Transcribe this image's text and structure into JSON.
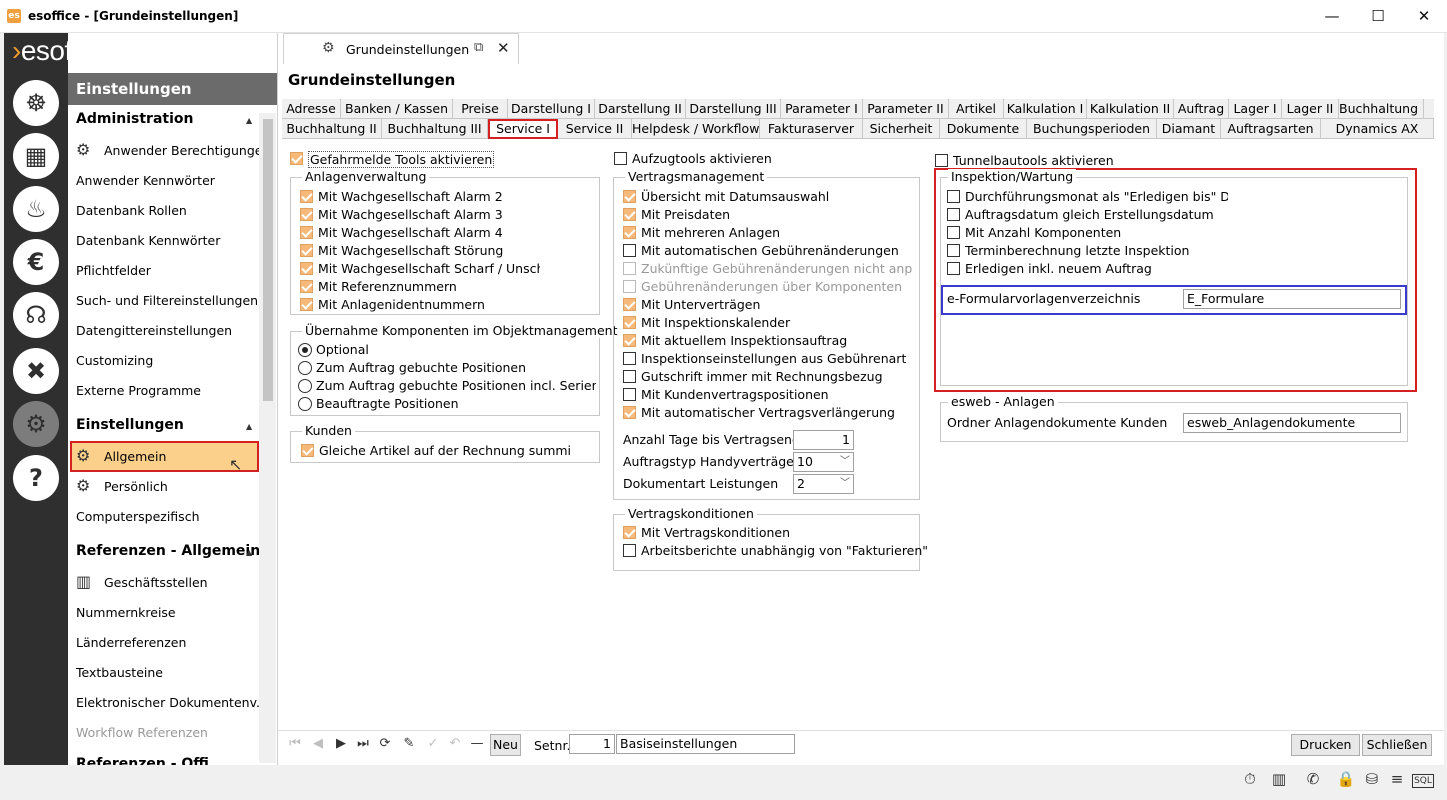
{
  "window": {
    "title": "esoffice - [Grundeinstellungen]",
    "app_icon": "esoffice-app-icon",
    "minimize": "—",
    "maximize": "☐",
    "close": "✕"
  },
  "logo": {
    "arrow": "›",
    "text": "esoffice"
  },
  "rail": [
    "helm-icon",
    "calendar-icon",
    "alarm-icon",
    "euro-icon",
    "headset-icon",
    "tools-icon",
    "gears-icon",
    "help-icon"
  ],
  "sidebar": {
    "header": "Einstellungen",
    "sections": {
      "admin": "Administration",
      "einst": "Einstellungen",
      "ref": "Referenzen - Allgemein",
      "ref2": "Referenzen - Offi..."
    },
    "admin_items": [
      "Anwender Berechtigungen",
      "Anwender Kennwörter",
      "Datenbank Rollen",
      "Datenbank Kennwörter",
      "Pflichtfelder",
      "Such- und Filtereinstellungen",
      "Datengittereinstellungen",
      "Customizing",
      "Externe Programme"
    ],
    "einst_items": [
      "Allgemein",
      "Persönlich",
      "Computerspezifisch"
    ],
    "ref_items": [
      "Geschäftsstellen",
      "Nummernkreise",
      "Länderreferenzen",
      "Textbausteine",
      "Elektronischer Dokumentenv...",
      "Workflow Referenzen"
    ]
  },
  "doc_tab": {
    "label": "Grundeinstellungen",
    "popout": "⧉",
    "close": "✕"
  },
  "page_title": "Grundeinstellungen",
  "tabs_row1": [
    "Adresse",
    "Banken / Kassen",
    "Preise",
    "Darstellung I",
    "Darstellung II",
    "Darstellung III",
    "Parameter I",
    "Parameter II",
    "Artikel",
    "Kalkulation I",
    "Kalkulation II",
    "Auftrag",
    "Lager I",
    "Lager II",
    "Buchhaltung I"
  ],
  "tabs_row2": [
    "Buchhaltung II",
    "Buchhaltung III",
    "Service I",
    "Service II",
    "Helpdesk / Workflow",
    "Fakturaserver",
    "Sicherheit",
    "Dokumente",
    "Buchungsperioden",
    "Diamant",
    "Auftragsarten",
    "Dynamics AX"
  ],
  "col1": {
    "top_check": {
      "label": "Gefahrmelde Tools aktivieren",
      "checked": true
    },
    "anlagen_title": "Anlagenverwaltung",
    "anlagen": [
      {
        "label": "Mit Wachgesellschaft Alarm 2",
        "checked": true
      },
      {
        "label": "Mit Wachgesellschaft Alarm 3",
        "checked": true
      },
      {
        "label": "Mit Wachgesellschaft Alarm 4",
        "checked": true
      },
      {
        "label": "Mit Wachgesellschaft Störung",
        "checked": true
      },
      {
        "label": "Mit Wachgesellschaft Scharf / Unscharf",
        "checked": true
      },
      {
        "label": "Mit Referenznummern",
        "checked": true
      },
      {
        "label": "Mit Anlagenidentnummern",
        "checked": true
      }
    ],
    "uebernahme_title": "Übernahme Komponenten im Objektmanagement",
    "uebernahme": [
      {
        "label": "Optional",
        "selected": true
      },
      {
        "label": "Zum Auftrag gebuchte Positionen",
        "selected": false
      },
      {
        "label": "Zum Auftrag gebuchte Positionen incl. Seriennr.",
        "selected": false
      },
      {
        "label": "Beauftragte Positionen",
        "selected": false
      }
    ],
    "kunden_title": "Kunden",
    "kunden": [
      {
        "label": "Gleiche Artikel auf der Rechnung summieren",
        "checked": true
      }
    ]
  },
  "col2": {
    "top_check": {
      "label": "Aufzugtools aktivieren",
      "checked": false
    },
    "vertrag_title": "Vertragsmanagement",
    "vertrag": [
      {
        "label": "Übersicht mit Datumsauswahl",
        "checked": true,
        "disabled": false
      },
      {
        "label": "Mit Preisdaten",
        "checked": true,
        "disabled": false
      },
      {
        "label": "Mit mehreren Anlagen",
        "checked": true,
        "disabled": false
      },
      {
        "label": "Mit automatischen Gebührenänderungen",
        "checked": false,
        "disabled": false
      },
      {
        "label": "Zukünftige Gebührenänderungen nicht anpassen",
        "checked": false,
        "disabled": true
      },
      {
        "label": "Gebührenänderungen über Komponenten",
        "checked": false,
        "disabled": true
      },
      {
        "label": "Mit Unterverträgen",
        "checked": true,
        "disabled": false
      },
      {
        "label": "Mit Inspektionskalender",
        "checked": true,
        "disabled": false
      },
      {
        "label": "Mit aktuellem Inspektionsauftrag",
        "checked": true,
        "disabled": false
      },
      {
        "label": "Inspektionseinstellungen aus Gebührenart",
        "checked": false,
        "disabled": false
      },
      {
        "label": "Gutschrift immer mit Rechnungsbezug",
        "checked": false,
        "disabled": false
      },
      {
        "label": "Mit Kundenvertragspositionen",
        "checked": false,
        "disabled": false
      },
      {
        "label": "Mit automatischer Vertragsverlängerung",
        "checked": true,
        "disabled": false
      }
    ],
    "fields": [
      {
        "label": "Anzahl Tage bis Vertragsende",
        "value": "1"
      },
      {
        "label": "Auftragstyp Handyverträge",
        "value": "10"
      },
      {
        "label": "Dokumentart Leistungen",
        "value": "2"
      }
    ],
    "kond_title": "Vertragskonditionen",
    "kond": [
      {
        "label": "Mit Vertragskonditionen",
        "checked": true
      },
      {
        "label": "Arbeitsberichte unabhängig von \"Fakturieren\"",
        "checked": false
      }
    ]
  },
  "col3": {
    "top_check": {
      "label": "Tunnelbautools aktivieren",
      "checked": false
    },
    "insp_title": "Inspektion/Wartung",
    "insp": [
      {
        "label": "Durchführungsmonat als \"Erledigen bis\" Datum",
        "checked": false
      },
      {
        "label": "Auftragsdatum gleich Erstellungsdatum",
        "checked": false
      },
      {
        "label": "Mit Anzahl Komponenten",
        "checked": false
      },
      {
        "label": "Terminberechnung letzte Inspektion",
        "checked": false
      },
      {
        "label": "Erledigen inkl. neuem Auftrag",
        "checked": false
      }
    ],
    "formular": {
      "label": "e-Formularvorlagenverzeichnis",
      "value": "E_Formulare"
    },
    "esweb_title": "esweb - Anlagen",
    "esweb": {
      "label": "Ordner Anlagendokumente Kunden",
      "value": "esweb_Anlagendokumente"
    }
  },
  "bottom": {
    "nav": [
      "⏮",
      "◀",
      "▶",
      "⏭",
      "⟳",
      "✎",
      "✓",
      "↶",
      "—"
    ],
    "new_label": "Neu",
    "setnr_label": "Setnr.",
    "setnr_value": "1",
    "set_name": "Basiseinstellungen",
    "print_label": "Drucken",
    "close_label": "Schließen"
  },
  "status_icons": [
    "stopwatch-icon",
    "building-icon",
    "phone-icon",
    "lock-icon",
    "database-icon",
    "stack-icon",
    "sql-icon"
  ],
  "colors": {
    "accent": "#f29a2e",
    "rail": "#2f2f2f",
    "highlight": "#d32020",
    "checked": "#f7b97a",
    "selection": "#fbd08a"
  }
}
